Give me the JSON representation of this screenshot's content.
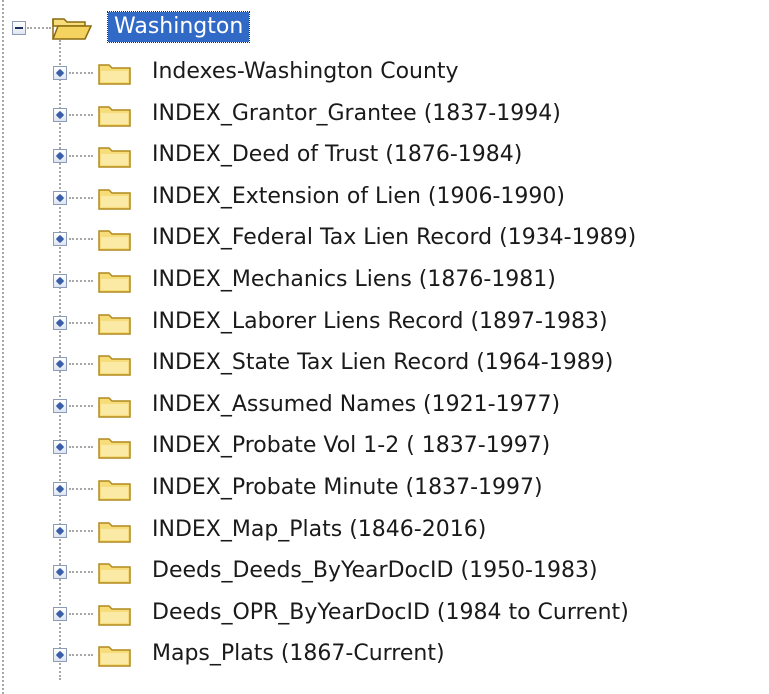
{
  "tree": {
    "root": {
      "label": "Washington",
      "expanded": true,
      "selected": true,
      "icon": "folder-open-icon"
    },
    "children": [
      {
        "label": "Indexes-Washington County",
        "icon": "folder-icon"
      },
      {
        "label": "INDEX_Grantor_Grantee (1837-1994)",
        "icon": "folder-icon"
      },
      {
        "label": "INDEX_Deed of Trust (1876-1984)",
        "icon": "folder-icon"
      },
      {
        "label": "INDEX_Extension of Lien (1906-1990)",
        "icon": "folder-icon"
      },
      {
        "label": "INDEX_Federal Tax Lien Record (1934-1989)",
        "icon": "folder-icon"
      },
      {
        "label": "INDEX_Mechanics Liens (1876-1981)",
        "icon": "folder-icon"
      },
      {
        "label": "INDEX_Laborer Liens Record (1897-1983)",
        "icon": "folder-icon"
      },
      {
        "label": "INDEX_State Tax Lien Record (1964-1989)",
        "icon": "folder-icon"
      },
      {
        "label": "INDEX_Assumed Names (1921-1977)",
        "icon": "folder-icon"
      },
      {
        "label": "INDEX_Probate Vol 1-2 ( 1837-1997)",
        "icon": "folder-icon"
      },
      {
        "label": "INDEX_Probate Minute (1837-1997)",
        "icon": "folder-icon"
      },
      {
        "label": "INDEX_Map_Plats (1846-2016)",
        "icon": "folder-icon"
      },
      {
        "label": "Deeds_Deeds_ByYearDocID (1950-1983)",
        "icon": "folder-icon"
      },
      {
        "label": "Deeds_OPR_ByYearDocID (1984 to Current)",
        "icon": "folder-icon"
      },
      {
        "label": "Maps_Plats (1867-Current)",
        "icon": "folder-icon"
      }
    ]
  },
  "colors": {
    "selection": "#3169c6",
    "folder_fill": "#f7dd7a",
    "folder_edge": "#b08a1e",
    "connector": "#a8a8a8"
  }
}
